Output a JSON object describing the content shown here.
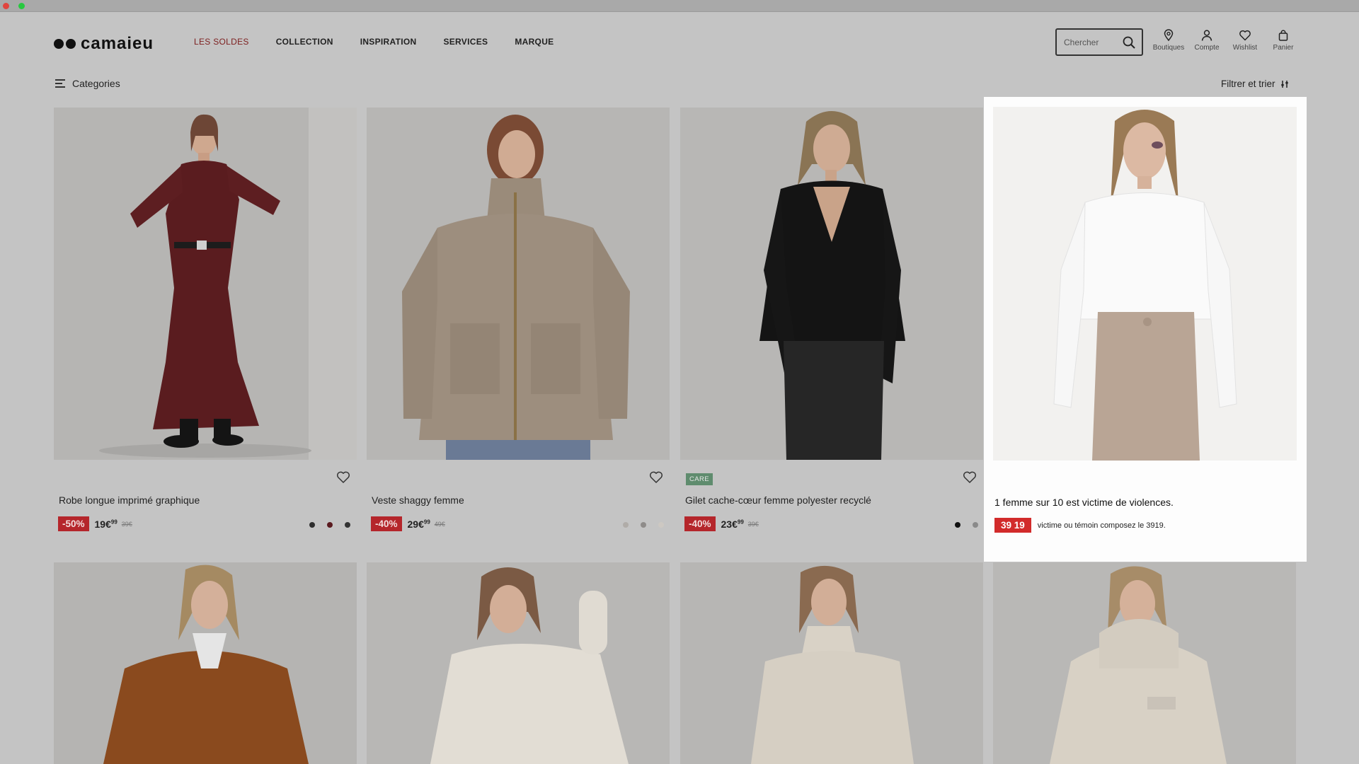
{
  "window": {
    "controls": [
      "close",
      "zoom"
    ]
  },
  "brand": {
    "logo_text": "camaieu"
  },
  "nav": {
    "items": [
      {
        "label": "LES SOLDES"
      },
      {
        "label": "COLLECTION"
      },
      {
        "label": "INSPIRATION"
      },
      {
        "label": "SERVICES"
      },
      {
        "label": "MARQUE"
      }
    ]
  },
  "search": {
    "placeholder": "Chercher",
    "icon": "search-icon"
  },
  "tools": [
    {
      "label": "Boutiques",
      "icon": "location-pin-icon"
    },
    {
      "label": "Compte",
      "icon": "user-icon"
    },
    {
      "label": "Wishlist",
      "icon": "heart-icon"
    },
    {
      "label": "Panier",
      "icon": "bag-icon"
    }
  ],
  "toolbar": {
    "categories_label": "Categories",
    "filter_label": "Filtrer et trier"
  },
  "products": [
    {
      "name": "Robe longue imprimé graphique",
      "discount": "-50%",
      "price_main": "19€",
      "price_cents": "99",
      "old_price": "39€",
      "badge": "",
      "swatches": [
        "#2e2e2e",
        "#5a1a1f",
        "#333333"
      ]
    },
    {
      "name": "Veste shaggy femme",
      "discount": "-40%",
      "price_main": "29€",
      "price_cents": "99",
      "old_price": "49€",
      "badge": "",
      "swatches": [
        "#b0aca8",
        "#8f8c8a",
        "#cdc8c2"
      ]
    },
    {
      "name": "Gilet cache-cœur femme polyester recyclé",
      "discount": "-40%",
      "price_main": "23€",
      "price_cents": "99",
      "old_price": "39€",
      "badge": "CARE",
      "swatches": [
        "#111111",
        "#8a8a8a"
      ]
    }
  ],
  "promo": {
    "headline": "1 femme sur 10 est victime de violences.",
    "badge": "39 19",
    "note": "victime ou témoin composez le 3919."
  },
  "colors": {
    "accent_sale": "#7d2020",
    "discount_red": "#b5262b",
    "promo_red": "#d22b2b",
    "care_green": "#5f8c6e",
    "page_bg": "#c4c4c4"
  }
}
